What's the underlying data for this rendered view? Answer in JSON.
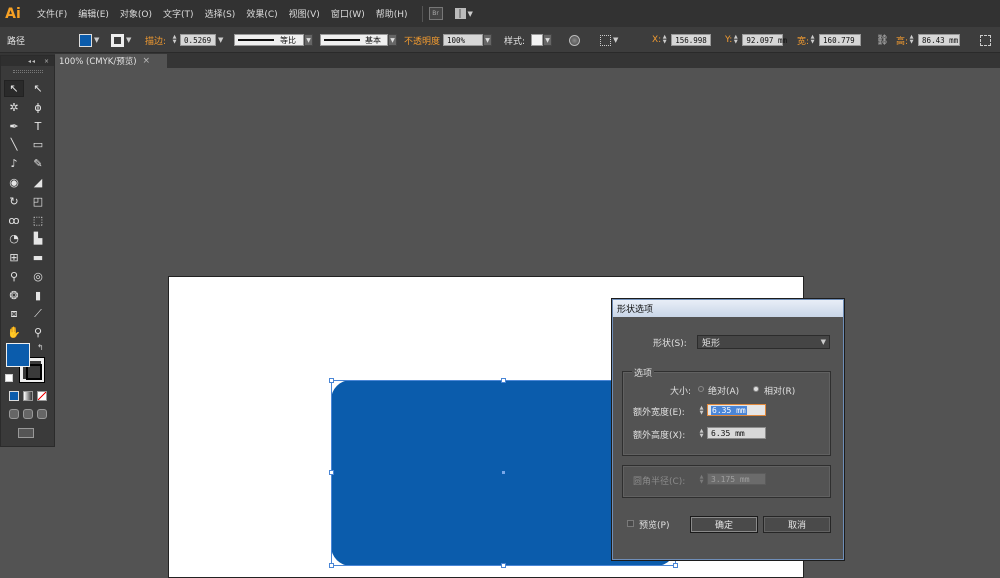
{
  "app": {
    "logo_text": "Ai",
    "brand_color": "#f7a125"
  },
  "menu": {
    "items": [
      "文件(F)",
      "编辑(E)",
      "对象(O)",
      "文字(T)",
      "选择(S)",
      "效果(C)",
      "视图(V)",
      "窗口(W)",
      "帮助(H)"
    ],
    "bridge_label": "Br"
  },
  "control_bar": {
    "object_type": "路径",
    "fill_color": "#0b5cac",
    "stroke_label": "描边:",
    "stroke_weight": "0.5269",
    "stroke_profile": "等比",
    "brush_label": "基本",
    "opacity_label": "不透明度",
    "opacity_value": "100%",
    "style_label": "样式:",
    "x_label": "X:",
    "x_value": "156.998",
    "y_label": "Y:",
    "y_value": "92.097 mm",
    "w_label": "宽:",
    "w_value": "160.779",
    "h_label": "高:",
    "h_value": "86.43 mm"
  },
  "document_tab": {
    "title": "100% (CMYK/预览)",
    "close_label": "×"
  },
  "toolbox": {
    "fill_color": "#0b5cac",
    "stroke_color": "#ffffff",
    "tools": [
      [
        "selection-tool-icon",
        "direct-selection-tool-icon"
      ],
      [
        "magic-wand-tool-icon",
        "lasso-tool-icon"
      ],
      [
        "pen-tool-icon",
        "type-tool-icon"
      ],
      [
        "line-segment-tool-icon",
        "rounded-rectangle-tool-icon"
      ],
      [
        "paintbrush-tool-icon",
        "pencil-tool-icon"
      ],
      [
        "blob-brush-tool-icon",
        "eraser-tool-icon"
      ],
      [
        "rotate-tool-icon",
        "scale-tool-icon"
      ],
      [
        "warp-tool-icon",
        "free-transform-tool-icon"
      ],
      [
        "shape-builder-tool-icon",
        "perspective-grid-tool-icon"
      ],
      [
        "mesh-tool-icon",
        "gradient-tool-icon"
      ],
      [
        "eyedropper-tool-icon",
        "blend-tool-icon"
      ],
      [
        "symbol-sprayer-tool-icon",
        "column-graph-tool-icon"
      ],
      [
        "artboard-tool-icon",
        "slice-tool-icon"
      ],
      [
        "hand-tool-icon",
        "zoom-tool-icon"
      ]
    ],
    "tool_glyphs": [
      [
        "↖",
        "↖"
      ],
      [
        "✲",
        "ϕ"
      ],
      [
        "✒",
        "T"
      ],
      [
        "╲",
        "▭"
      ],
      [
        "♪",
        "✎"
      ],
      [
        "◉",
        "◢"
      ],
      [
        "↻",
        "◰"
      ],
      [
        "ꝏ",
        "⬚"
      ],
      [
        "◔",
        "▙"
      ],
      [
        "⊞",
        "▬"
      ],
      [
        "⚲",
        "◎"
      ],
      [
        "❂",
        "▮"
      ],
      [
        "⧈",
        "⟋"
      ],
      [
        "✋",
        "⚲"
      ]
    ]
  },
  "dialog": {
    "title": "形状选项",
    "shape_label": "形状(S):",
    "shape_value": "矩形",
    "options_group": "选项",
    "size_label": "大小:",
    "size_absolute": "绝对(A)",
    "size_relative": "相对(R)",
    "size_selected": "relative",
    "extra_width_label": "额外宽度(E):",
    "extra_width_value": "6.35 mm",
    "extra_height_label": "额外高度(X):",
    "extra_height_value": "6.35 mm",
    "corner_radius_label": "圆角半径(C):",
    "corner_radius_value": "3.175 mm",
    "preview_label": "预览(P)",
    "preview_checked": false,
    "ok_label": "确定",
    "cancel_label": "取消"
  }
}
